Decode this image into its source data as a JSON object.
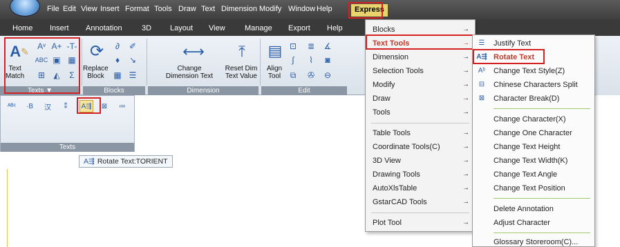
{
  "menubar": {
    "items": [
      "File",
      "Edit",
      "View",
      "Insert",
      "Format",
      "Tools",
      "Draw",
      "Text",
      "Dimension",
      "Modify",
      "Window",
      "Help"
    ],
    "express": "Express"
  },
  "ribbon_tabs": [
    "Home",
    "Insert",
    "Annotation",
    "3D",
    "Layout",
    "View",
    "Manage",
    "Export",
    "Help"
  ],
  "ribbon": {
    "text_match": "Text\nMatch",
    "replace_block": "Replace\nBlock",
    "change_dimension_text": "Change\nDimension Text",
    "reset_dim_text_value": "Reset Dim\nText Value",
    "align_tool": "Align\nTool",
    "panels": [
      "Texts ▼",
      "Blocks",
      "Dimension",
      "Edit"
    ]
  },
  "expanded_panel": {
    "title": "Texts"
  },
  "tooltip": "Rotate Text:TORIENT",
  "express_menu": {
    "items": [
      {
        "label": "Blocks",
        "arrow": "→"
      },
      {
        "label": "Text Tools",
        "arrow": "→"
      },
      {
        "label": "Dimension",
        "arrow": "→"
      },
      {
        "label": "Selection Tools",
        "arrow": "→"
      },
      {
        "label": "Modify",
        "arrow": "→"
      },
      {
        "label": "Draw",
        "arrow": "→"
      },
      {
        "label": "Tools",
        "arrow": "→"
      },
      {
        "label": "Table Tools",
        "arrow": "→"
      },
      {
        "label": "Coordinate Tools(C)",
        "arrow": "→"
      },
      {
        "label": "3D View",
        "arrow": "→"
      },
      {
        "label": "Drawing Tools",
        "arrow": "→"
      },
      {
        "label": "AutoXlsTable",
        "arrow": "→"
      },
      {
        "label": "GstarCAD Tools",
        "arrow": "→"
      },
      {
        "label": "Plot Tool",
        "arrow": "→"
      }
    ]
  },
  "text_tools_submenu": {
    "items": [
      {
        "label": "Justify Text",
        "icon": "justify-text-icon"
      },
      {
        "label": "Rotate Text",
        "icon": "rotate-text-icon"
      },
      {
        "label": "Change Text Style(Z)",
        "icon": "text-style-icon"
      },
      {
        "label": "Chinese Characters Split",
        "icon": "split-icon"
      },
      {
        "label": "Character Break(D)",
        "icon": "break-icon"
      },
      {
        "label": "Change Character(X)"
      },
      {
        "label": "Change One Character"
      },
      {
        "label": "Change Text Height"
      },
      {
        "label": "Change Text Width(K)"
      },
      {
        "label": "Change Text Angle"
      },
      {
        "label": "Change Text Position"
      },
      {
        "label": "Delete Annotation"
      },
      {
        "label": "Adjust Character"
      },
      {
        "label": "Glossary Storeroom(C)..."
      }
    ]
  },
  "colors": {
    "highlight_red": "#d42020",
    "selected_text": "#c0392b",
    "express_bg": "#e9d36c",
    "ribbon_dark": "#3a3a3a"
  }
}
